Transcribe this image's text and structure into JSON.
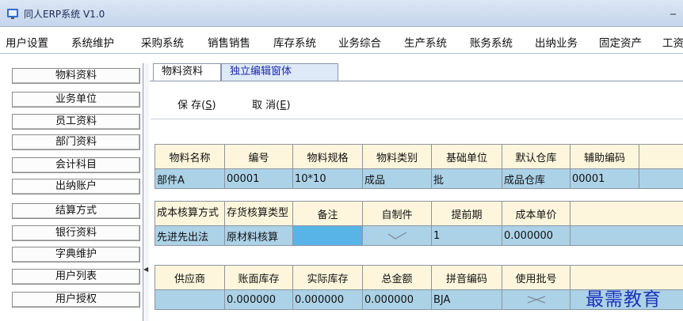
{
  "window": {
    "title": "同人ERP系统 V1.0",
    "minimize_glyph": "_"
  },
  "menu": [
    "用户设置",
    "系统维护",
    "采购系统",
    "销售销售",
    "库存系统",
    "业务综合",
    "生产系统",
    "账务系统",
    "出纳业务",
    "固定资产",
    "工资"
  ],
  "sidebar": [
    "物料资料",
    "业务单位",
    "员工资料",
    "部门资料",
    "会计科目",
    "出纳账户",
    "结算方式",
    "银行资料",
    "字典维护",
    "用户列表",
    "用户授权"
  ],
  "tabs": [
    "物料资料",
    "独立编辑窗体"
  ],
  "actions": {
    "save": {
      "label": "保 存(",
      "hotkey": "S",
      "suffix": ")"
    },
    "cancel": {
      "label": "取 消(",
      "hotkey": "E",
      "suffix": ")"
    }
  },
  "grid1": {
    "headers": [
      "物料名称",
      "编号",
      "物料规格",
      "物料类别",
      "基础单位",
      "默认仓库",
      "辅助编码",
      ""
    ],
    "values": [
      "部件A",
      "00001",
      "10*10",
      "成品",
      "批",
      "成品仓库",
      "00001",
      ""
    ]
  },
  "grid2": {
    "headers": [
      "成本核算方式",
      "存货核算类型",
      "备注",
      "自制件",
      "提前期",
      "成本单价",
      ""
    ],
    "values": [
      "先进先出法",
      "原材料核算",
      "",
      "check",
      "1",
      "0.000000",
      ""
    ]
  },
  "grid3": {
    "headers": [
      "供应商",
      "账面库存",
      "实际库存",
      "总金额",
      "拼音编码",
      "使用批号",
      ""
    ],
    "values": [
      "",
      "0.000000",
      "0.000000",
      "0.000000",
      "BJA",
      "cross",
      ""
    ]
  },
  "watermark": "最需教育",
  "colors": {
    "header_fill": "#fdf6dc",
    "value_fill": "#acd2e7",
    "active_tab": "#dde9f7",
    "titlebar": "#c5d5ec"
  }
}
